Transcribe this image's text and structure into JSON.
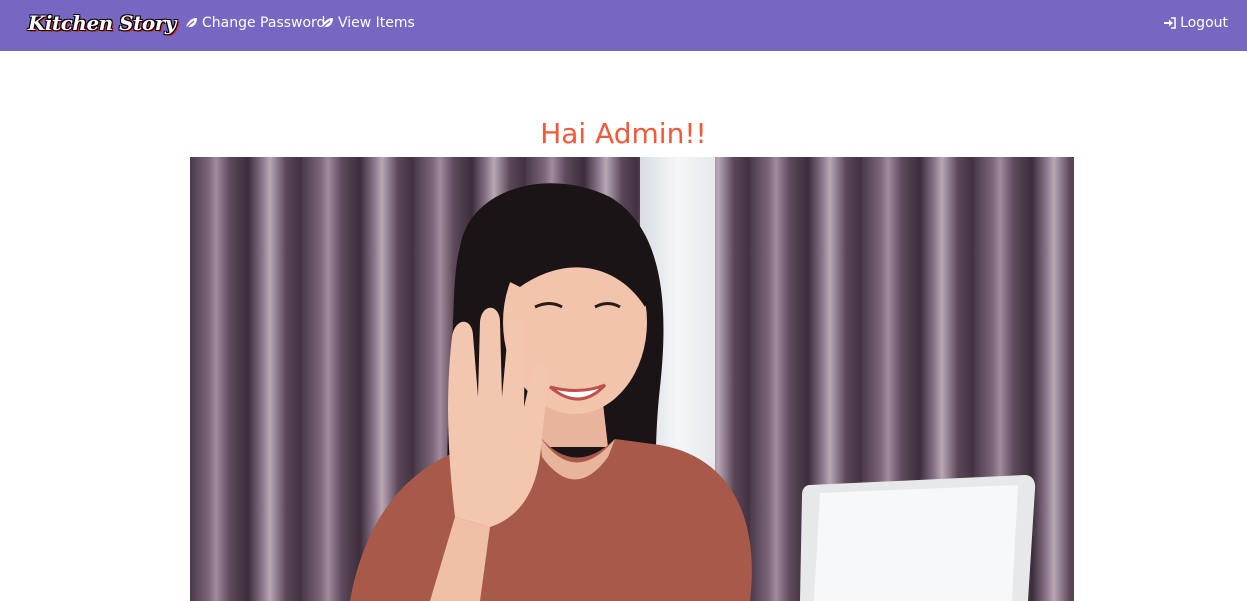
{
  "navbar": {
    "brand": "Kitchen Story",
    "links": [
      {
        "label": "Change Password",
        "icon": "leaf-icon"
      },
      {
        "label": "View Items",
        "icon": "leaf-icon"
      }
    ],
    "logout": {
      "label": "Logout",
      "icon": "sign-in-icon"
    },
    "background_color": "#7766c2"
  },
  "main": {
    "greeting": "Hai Admin!!",
    "greeting_color": "#f05a3a",
    "image": {
      "alt": "Woman waving at laptop"
    }
  }
}
